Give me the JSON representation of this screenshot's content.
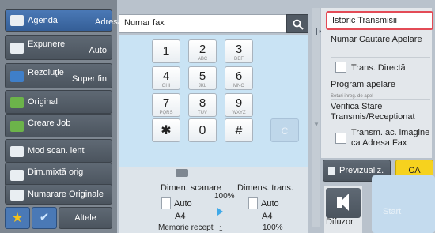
{
  "left_menu": {
    "agenda": "Agenda",
    "expunere": {
      "label": "Expunere",
      "value": "Auto"
    },
    "rezolutie": {
      "label": "Rezoluţie",
      "value": "Super fin"
    },
    "original": "Original",
    "creare_job": "Creare Job",
    "mod_scan": "Mod scan. lent",
    "dim_mixta": "Dim.mixtă orig",
    "numarare": "Numarare Originale",
    "altele": "Altele"
  },
  "address": {
    "label": "Adresă",
    "placeholder": "Numar fax"
  },
  "keypad": [
    {
      "d": "1",
      "s": ""
    },
    {
      "d": "2",
      "s": "ABC"
    },
    {
      "d": "3",
      "s": "DEF"
    },
    {
      "d": "4",
      "s": "GHI"
    },
    {
      "d": "5",
      "s": "JKL"
    },
    {
      "d": "6",
      "s": "MNO"
    },
    {
      "d": "7",
      "s": "PQRS"
    },
    {
      "d": "8",
      "s": "TUV"
    },
    {
      "d": "9",
      "s": "WXYZ"
    },
    {
      "d": "✱",
      "s": ""
    },
    {
      "d": "0",
      "s": ""
    },
    {
      "d": "#",
      "s": ""
    }
  ],
  "keypad_clear": "C",
  "status": {
    "dimen_scanare": "Dimen. scanare",
    "dimens_trans": "Dimens. trans.",
    "zoom": "100%",
    "scan_mode": "Auto",
    "scan_size": "A4",
    "trans_mode": "Auto",
    "trans_size": "A4",
    "memorie": "Memorie recept",
    "memorie_value": "1",
    "memorie_pct": "100%"
  },
  "right_panel": {
    "istoric": "Istoric Transmisii",
    "numar_cautare": "Numar Cautare Apelare",
    "trans_directa": "Trans. Directă",
    "program_apelare": "Program apelare",
    "program_sub": "Setari inreg. de apel",
    "verifica": "Verifica Stare Transmis/Receptionat",
    "transm_ac": "Transm. ac. imagine ca Adresa Fax"
  },
  "buttons": {
    "previzualiz": "Previzualiz.",
    "ca": "CA",
    "difuzor": "Difuzor",
    "start": "Start"
  },
  "colors": {
    "accent_blue": "#4a79b6",
    "highlight_red": "#e34b56",
    "ca_yellow": "#f6d21e",
    "keypad_bg": "#c9e3f4"
  }
}
